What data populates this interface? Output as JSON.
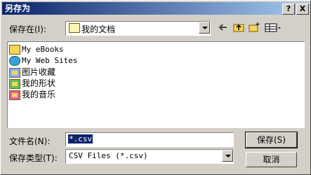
{
  "window": {
    "title": "另存为",
    "help_label": "?",
    "close_label": "X"
  },
  "save_in": {
    "label": "保存在(I):",
    "value": "我的文档"
  },
  "files": [
    {
      "name": "My eBooks",
      "icon": "folder-icon"
    },
    {
      "name": "My Web Sites",
      "icon": "globe-folder-icon"
    },
    {
      "name": "图片收藏",
      "icon": "pictures-folder-icon"
    },
    {
      "name": "我的形状",
      "icon": "shapes-folder-icon"
    },
    {
      "name": "我的音乐",
      "icon": "music-folder-icon"
    }
  ],
  "filename": {
    "label": "文件名(N):",
    "value": "*.csv"
  },
  "filetype": {
    "label": "保存类型(T):",
    "value": "CSV Files (*.csv)"
  },
  "buttons": {
    "save": "保存(S)",
    "cancel": "取消"
  },
  "colors": {
    "titlebar_start": "#0a246a",
    "titlebar_end": "#a6caf0",
    "selection": "#0a246a"
  }
}
